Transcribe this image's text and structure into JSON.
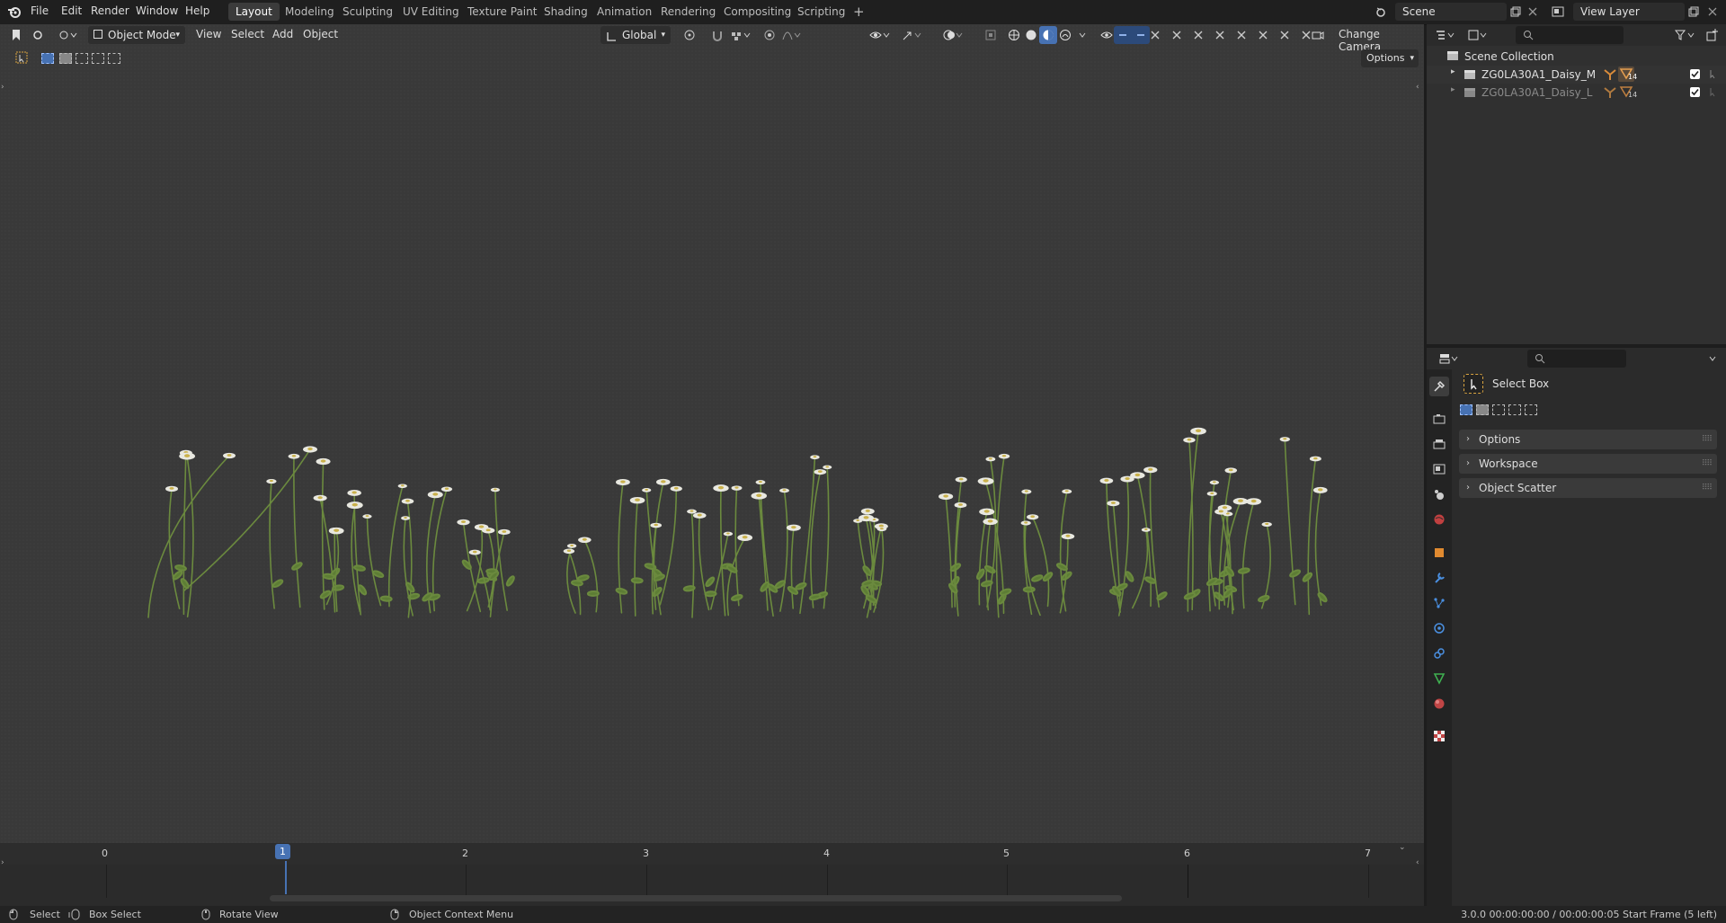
{
  "menu": [
    "File",
    "Edit",
    "Render",
    "Window",
    "Help"
  ],
  "workspaces": [
    {
      "label": "Layout",
      "active": true
    },
    {
      "label": "Modeling"
    },
    {
      "label": "Sculpting"
    },
    {
      "label": "UV Editing"
    },
    {
      "label": "Texture Paint"
    },
    {
      "label": "Shading"
    },
    {
      "label": "Animation"
    },
    {
      "label": "Rendering"
    },
    {
      "label": "Compositing"
    },
    {
      "label": "Scripting"
    }
  ],
  "add_workspace": "+",
  "scene": "Scene",
  "view_layer": "View Layer",
  "viewport": {
    "mode": "Object Mode",
    "menus": [
      "View",
      "Select",
      "Add",
      "Object"
    ],
    "orientation": "Global",
    "change_camera": "Change Camera",
    "options": "Options"
  },
  "timeline": {
    "frames": [
      "0",
      "1",
      "2",
      "3",
      "4",
      "5",
      "6",
      "7"
    ],
    "current_frame": "1"
  },
  "statusbar": {
    "select": "Select",
    "box_select": "Box Select",
    "rotate_view": "Rotate View",
    "context_menu": "Object Context Menu",
    "info": "3.0.0  00:00:00:00 / 00:00:00:05  Start Frame (5 left)"
  },
  "outliner": {
    "collection": "Scene Collection",
    "items": [
      {
        "name": "ZG0LA30A1_Daisy_M",
        "count": "14"
      },
      {
        "name": "ZG0LA30A1_Daisy_L",
        "count": "14"
      }
    ]
  },
  "properties": {
    "tool": "Select Box",
    "panels": [
      "Options",
      "Workspace",
      "Object Scatter"
    ]
  },
  "colors": {
    "accent": "#4772b3",
    "viewport_bg": "#393939",
    "plant_green": "#6b8a3e",
    "flower_white": "#e8e8e0"
  }
}
